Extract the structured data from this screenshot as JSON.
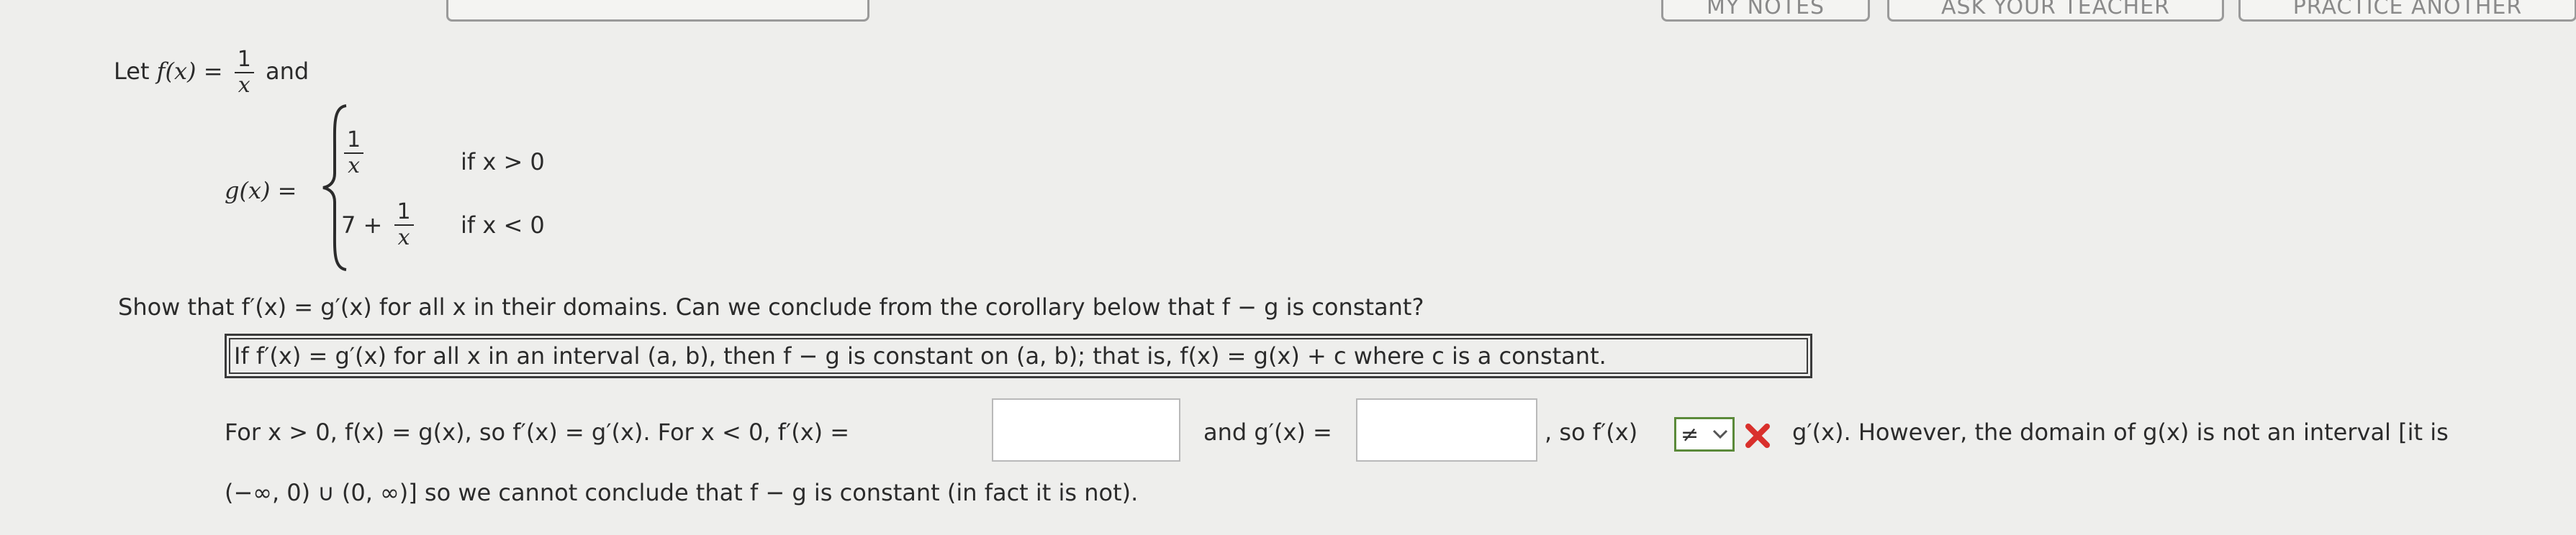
{
  "top_buttons": [
    {
      "label": ""
    },
    {
      "label": "MY NOTES"
    },
    {
      "label": "ASK YOUR TEACHER"
    },
    {
      "label": "PRACTICE ANOTHER"
    }
  ],
  "problem": {
    "let": "Let",
    "f_def": "f(x) =",
    "one": "1",
    "x": "x",
    "and": "and",
    "g_def": "g(x) =",
    "case1_cond": "if x > 0",
    "case2_prefix": "7 +",
    "case2_cond": "if x < 0",
    "show": "Show that  f′(x) = g′(x)  for all x in their domains. Can we conclude from the corollary below that  f − g  is constant?",
    "corollary": "If  f′(x) = g′(x)  for all x in an interval  (a, b),  then  f − g  is constant on  (a, b);  that is,  f(x) = g(x) + c  where c is a constant."
  },
  "answer_line": {
    "part1": "For  x > 0, f(x) = g(x),  so  f′(x) = g′(x).  For  x < 0, f′(x) =",
    "part2": "and  g′(x) =",
    "part3": ",  so  f′(x)",
    "select_value": "≠",
    "part4": "g′(x).  However, the domain of  g(x)  is not an interval [it is",
    "part5": "(−∞, 0) ∪ (0, ∞)]  so we cannot conclude that  f − g  is constant (in fact it is not)."
  },
  "inputs": {
    "f_prime_value": "",
    "g_prime_value": ""
  },
  "colors": {
    "incorrect": "#d9302c",
    "select_border": "#5b8a3a"
  }
}
